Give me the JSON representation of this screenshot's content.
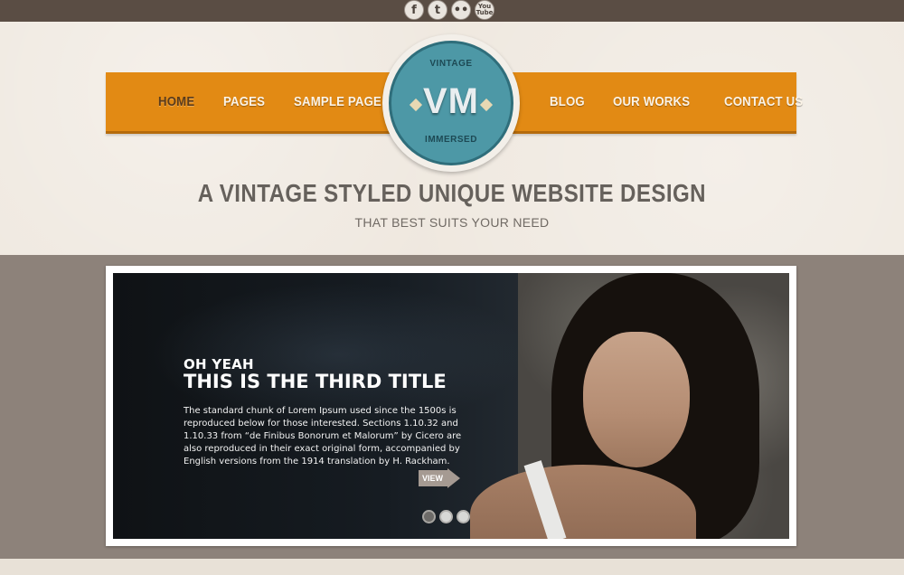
{
  "social": [
    {
      "name": "facebook-icon",
      "glyph": "f"
    },
    {
      "name": "twitter-icon",
      "glyph": "t"
    },
    {
      "name": "flickr-icon",
      "glyph": "••"
    },
    {
      "name": "youtube-icon",
      "glyph": "You Tube"
    }
  ],
  "nav": {
    "left": [
      "HOME",
      "PAGES",
      "SAMPLE PAGE"
    ],
    "right": [
      "BLOG",
      "OUR WORKS",
      "CONTACT US"
    ],
    "active": "HOME"
  },
  "logo": {
    "top": "VINTAGE",
    "initials": "VM",
    "bottom": "IMMERSED"
  },
  "hero": {
    "headline": "A VINTAGE STYLED UNIQUE WEBSITE DESIGN",
    "subheadline": "THAT BEST SUITS YOUR NEED"
  },
  "slider": {
    "kicker": "OH YEAH",
    "title": "THIS IS THE THIRD TITLE",
    "body": "The standard chunk of Lorem Ipsum used since the 1500s is reproduced below for those interested. Sections 1.10.32 and 1.10.33 from “de Finibus Bonorum et Malorum” by Cicero are also reproduced in their exact original form, accompanied by English versions from the 1914 translation by H. Rackham.",
    "view_label": "VIEW",
    "slide_count": 3,
    "active_slide": 1
  },
  "colors": {
    "nav_orange": "#e28a14",
    "logo_teal": "#4d98a6",
    "band_brown": "#8d827a",
    "top_strip": "#5a4d44"
  }
}
